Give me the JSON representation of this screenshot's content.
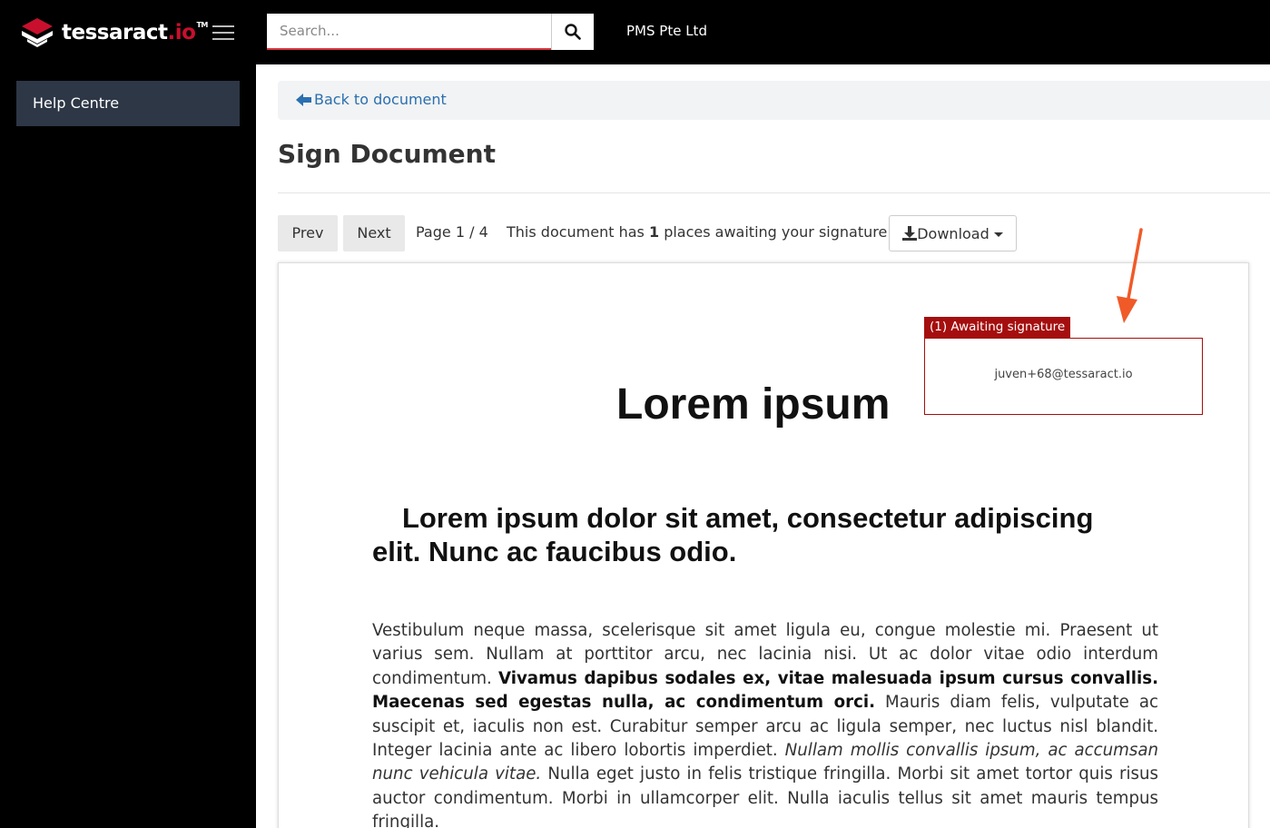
{
  "header": {
    "logo_text": "tessaract",
    "logo_suffix": ".io",
    "logo_tm": "TM",
    "search_placeholder": "Search...",
    "company_name": "PMS Pte Ltd",
    "icons": {
      "menu": "hamburger-icon",
      "search": "search-icon"
    }
  },
  "sidebar": {
    "items": [
      {
        "label": "Help Centre"
      }
    ]
  },
  "breadcrumb": {
    "back_label": "Back to document"
  },
  "page": {
    "title": "Sign Document"
  },
  "toolbar": {
    "prev_label": "Prev",
    "next_label": "Next",
    "page_info": "Page 1 / 4",
    "await_prefix": "This document has ",
    "await_count": "1",
    "await_suffix": " places awaiting your signature.",
    "download_label": "Download"
  },
  "signature": {
    "tag": "(1) Awaiting signature",
    "email": "juven+68@tessaract.io"
  },
  "document": {
    "title": "Lorem ipsum",
    "subtitle": "Lorem ipsum dolor sit amet, consectetur adipiscing elit. Nunc ac faucibus odio.",
    "body_1": "Vestibulum neque massa, scelerisque sit amet ligula eu, congue molestie mi. Praesent ut varius sem. Nullam at porttitor arcu, nec lacinia nisi. Ut ac dolor vitae odio interdum condimentum. ",
    "body_bold": "Vivamus dapibus sodales ex, vitae malesuada ipsum cursus convallis. Maecenas sed egestas nulla, ac condimentum orci.",
    "body_2": " Mauris diam felis, vulputate ac suscipit et, iaculis non est. Curabitur semper arcu ac ligula semper, nec luctus nisl blandit. Integer lacinia ante ac libero lobortis imperdiet. ",
    "body_italic": "Nullam mollis convallis ipsum, ac accumsan nunc vehicula vitae.",
    "body_3": " Nulla eget justo in felis tristique fringilla. Morbi sit amet tortor quis risus auctor condimentum. Morbi in ullamcorper elit. Nulla iaculis tellus sit amet mauris tempus fringilla."
  },
  "colors": {
    "accent_red": "#a50e0e",
    "link_blue": "#2a6fb0",
    "sidebar_active": "#2d3746",
    "annotation_arrow": "#f05a28"
  }
}
